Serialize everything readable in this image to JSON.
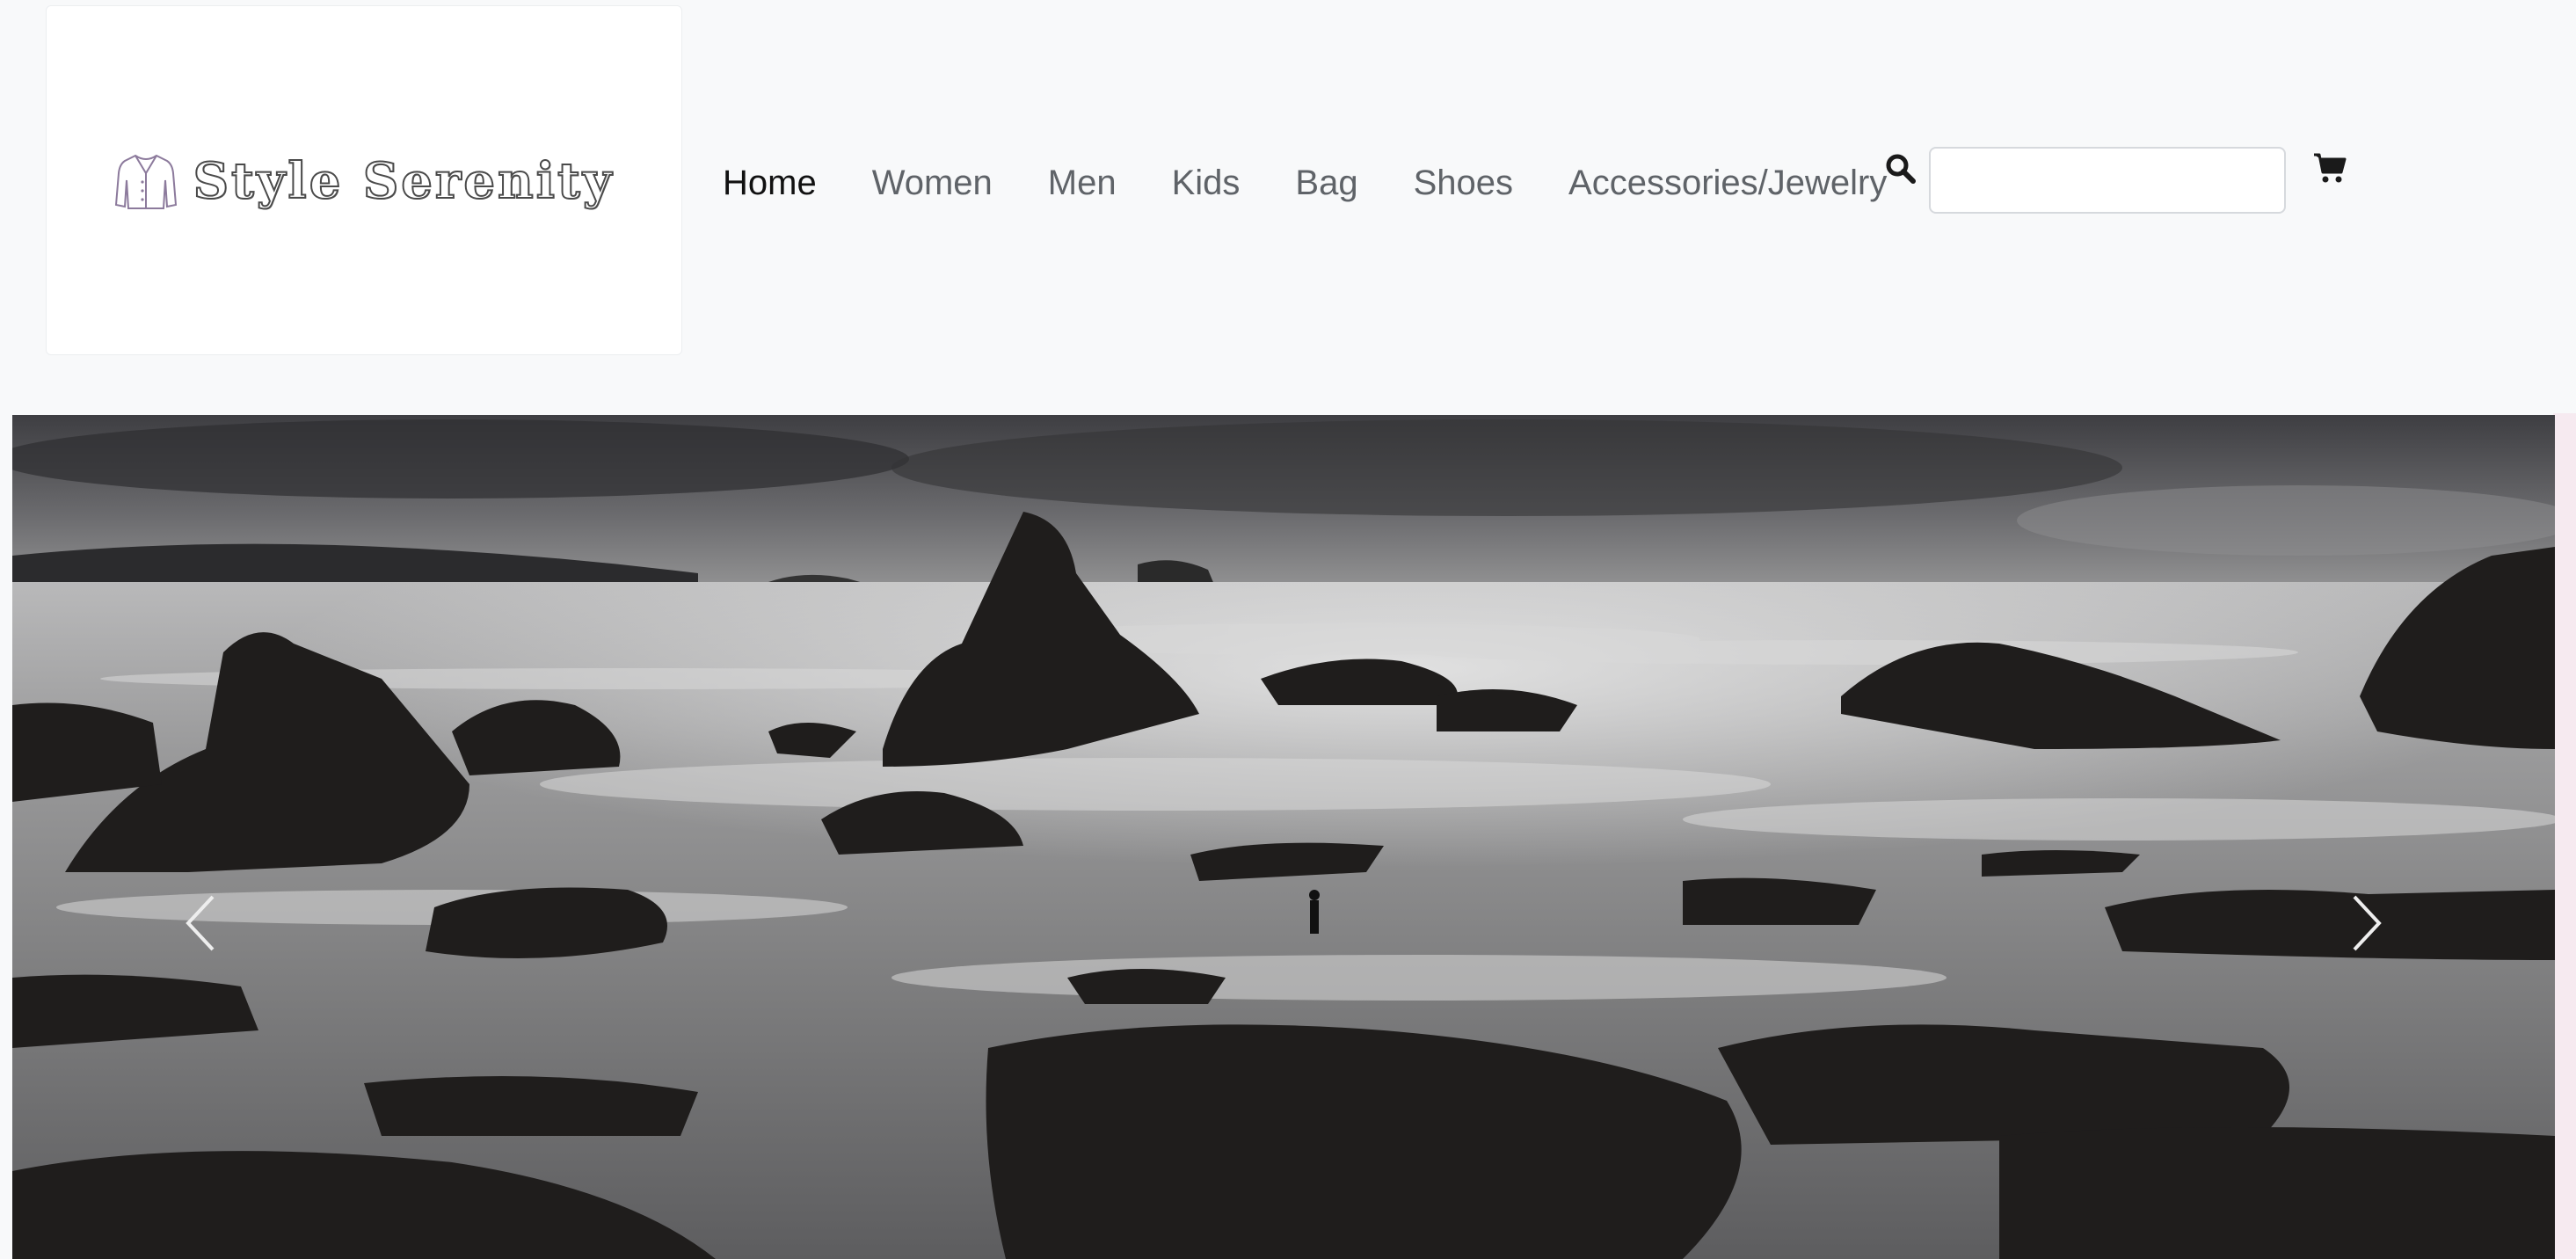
{
  "brand": {
    "name": "Style Serenity",
    "logo_icon": "jacket-icon"
  },
  "nav": {
    "items": [
      {
        "label": "Home",
        "active": true
      },
      {
        "label": "Women",
        "active": false
      },
      {
        "label": "Men",
        "active": false
      },
      {
        "label": "Kids",
        "active": false
      },
      {
        "label": "Bag",
        "active": false
      },
      {
        "label": "Shoes",
        "active": false
      },
      {
        "label": "Accessories/Jewelry",
        "active": false
      }
    ]
  },
  "search": {
    "icon": "search-icon",
    "value": "",
    "placeholder": ""
  },
  "cart": {
    "icon": "cart-icon"
  },
  "carousel": {
    "prev_icon": "chevron-left-icon",
    "next_icon": "chevron-right-icon"
  },
  "colors": {
    "navbar_bg": "#f8f9fa",
    "nav_link": "#5f6368",
    "nav_link_active": "#111111"
  }
}
